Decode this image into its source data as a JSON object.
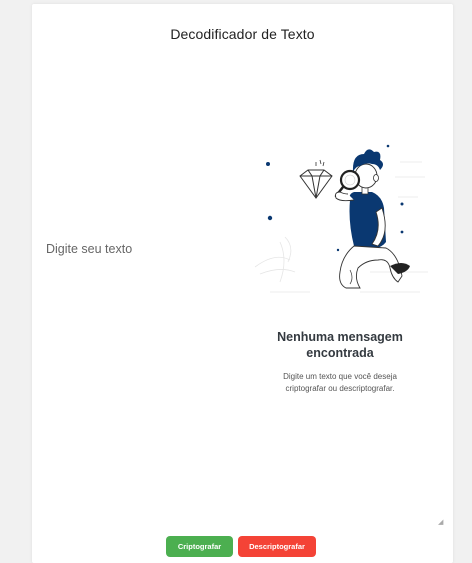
{
  "header": {
    "title": "Decodificador de Texto"
  },
  "input": {
    "placeholder": "Digite seu texto"
  },
  "empty_state": {
    "title_line1": "Nenhuma mensagem",
    "title_line2": "encontrada",
    "desc_line1": "Digite um texto que você deseja",
    "desc_line2": "criptografar ou descriptografar.",
    "illustration_icon": "person-with-magnifying-glass-illustration"
  },
  "actions": {
    "encrypt_label": "Criptografar",
    "decrypt_label": "Descriptografar"
  },
  "colors": {
    "encrypt": "#4caf50",
    "decrypt": "#f44336",
    "accent": "#0a3871"
  }
}
